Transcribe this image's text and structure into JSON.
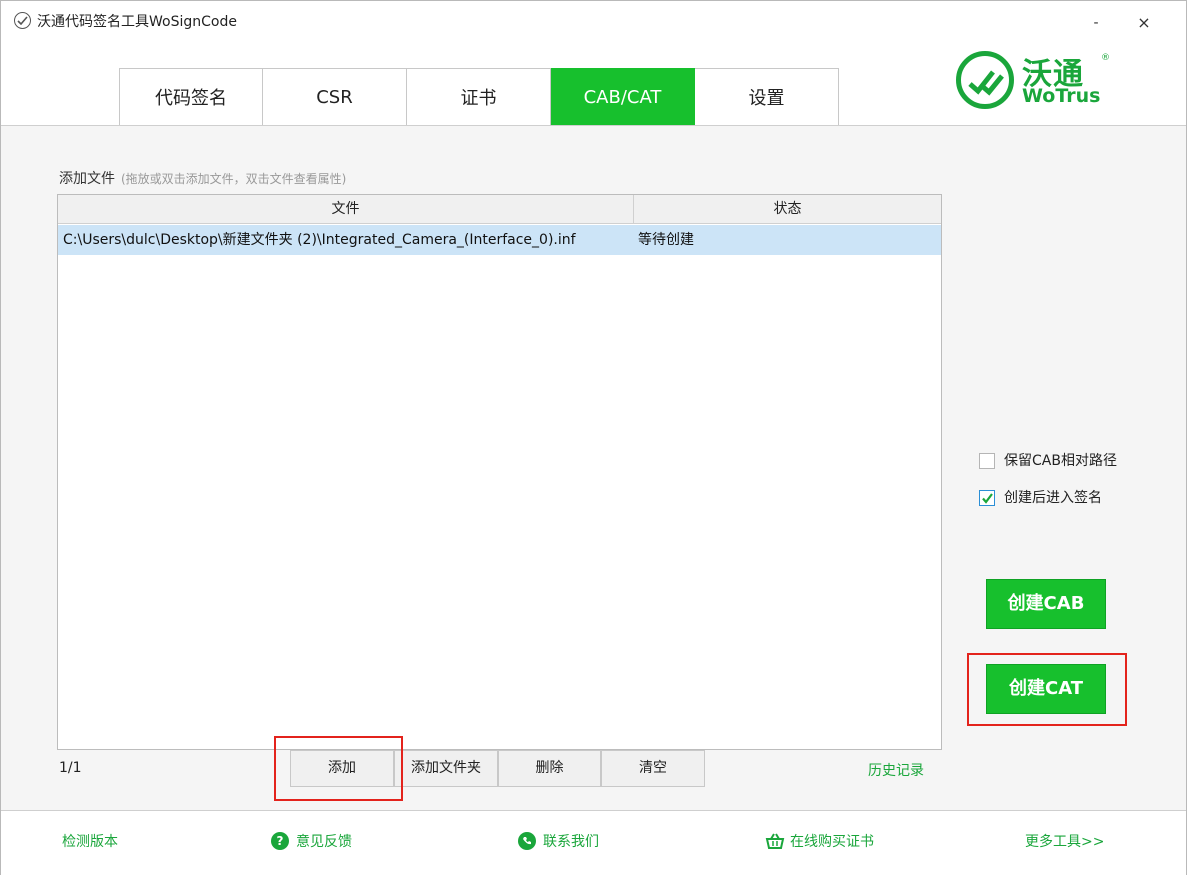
{
  "window": {
    "title": "沃通代码签名工具WoSignCode",
    "minimize_label": "-",
    "close_label": "×"
  },
  "tabs": [
    {
      "label": "代码签名",
      "active": false
    },
    {
      "label": "CSR",
      "active": false
    },
    {
      "label": "证书",
      "active": false
    },
    {
      "label": "CAB/CAT",
      "active": true
    },
    {
      "label": "设置",
      "active": false
    }
  ],
  "logo": {
    "cn": "沃通",
    "en": "WoTrus",
    "reg": "®"
  },
  "main": {
    "add_label": "添加文件",
    "add_hint": "(拖放或双击添加文件，双击文件查看属性)",
    "columns": {
      "file": "文件",
      "status": "状态"
    },
    "rows": [
      {
        "file": "C:\\Users\\dulc\\Desktop\\新建文件夹 (2)\\Integrated_Camera_(Interface_0).inf",
        "status": "等待创建"
      }
    ],
    "page_count": "1/1",
    "buttons": {
      "add": "添加",
      "add_folder": "添加文件夹",
      "delete": "删除",
      "clear": "清空"
    },
    "history": "历史记录"
  },
  "options": {
    "keep_path": {
      "label": "保留CAB相对路径",
      "checked": false
    },
    "sign_after": {
      "label": "创建后进入签名",
      "checked": true
    }
  },
  "actions": {
    "create_cab": "创建CAB",
    "create_cat": "创建CAT"
  },
  "footer": {
    "check_version": "检测版本",
    "feedback": "意见反馈",
    "contact": "联系我们",
    "buy": "在线购买证书",
    "more_tools": "更多工具>>"
  },
  "colors": {
    "accent": "#17c02d",
    "brand_green": "#1aa63b",
    "highlight": "#e3231c",
    "selected_row": "#cce4f7"
  }
}
